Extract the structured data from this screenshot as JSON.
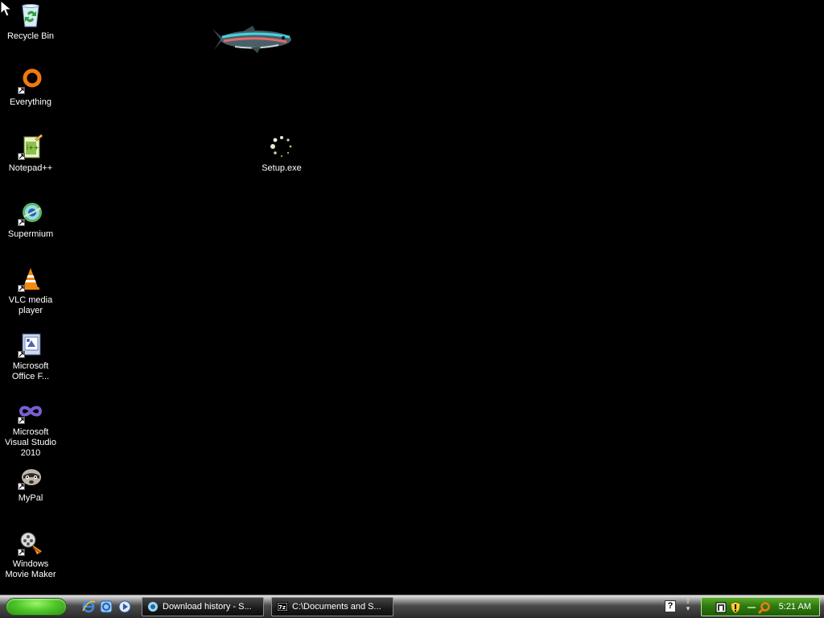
{
  "desktop": {
    "background_color": "#000000",
    "icons": [
      {
        "label": "Recycle Bin",
        "icon": "recycle-bin-icon"
      },
      {
        "label": "Everything",
        "icon": "everything-search-icon"
      },
      {
        "label": "Notepad++",
        "icon": "notepadpp-icon"
      },
      {
        "label": "Supermium",
        "icon": "supermium-browser-icon"
      },
      {
        "label": "VLC media player",
        "icon": "vlc-cone-icon"
      },
      {
        "label": "Microsoft Office F...",
        "icon": "office-file-icon"
      },
      {
        "label": "Microsoft Visual Studio 2010",
        "icon": "visual-studio-icon"
      },
      {
        "label": "MyPal",
        "icon": "mypal-raccoon-icon"
      },
      {
        "label": "Windows Movie Maker",
        "icon": "movie-maker-icon"
      },
      {
        "label": "Setup.exe",
        "icon": "setup-loading-icon"
      }
    ]
  },
  "taskbar": {
    "start_button_color": "#4fc92a",
    "quick_launch": [
      "internet-explorer-icon",
      "ie-alt-icon",
      "media-player-icon"
    ],
    "tasks": [
      {
        "label": "Download history - S...",
        "icon": "supermium-browser-icon"
      },
      {
        "label": "C:\\Documents and S...",
        "icon": "7zip-icon"
      }
    ],
    "tray": {
      "icons": [
        "network-icon",
        "security-shield-icon",
        "dash-icon",
        "search-icon"
      ],
      "clock": "5:21 AM"
    }
  }
}
